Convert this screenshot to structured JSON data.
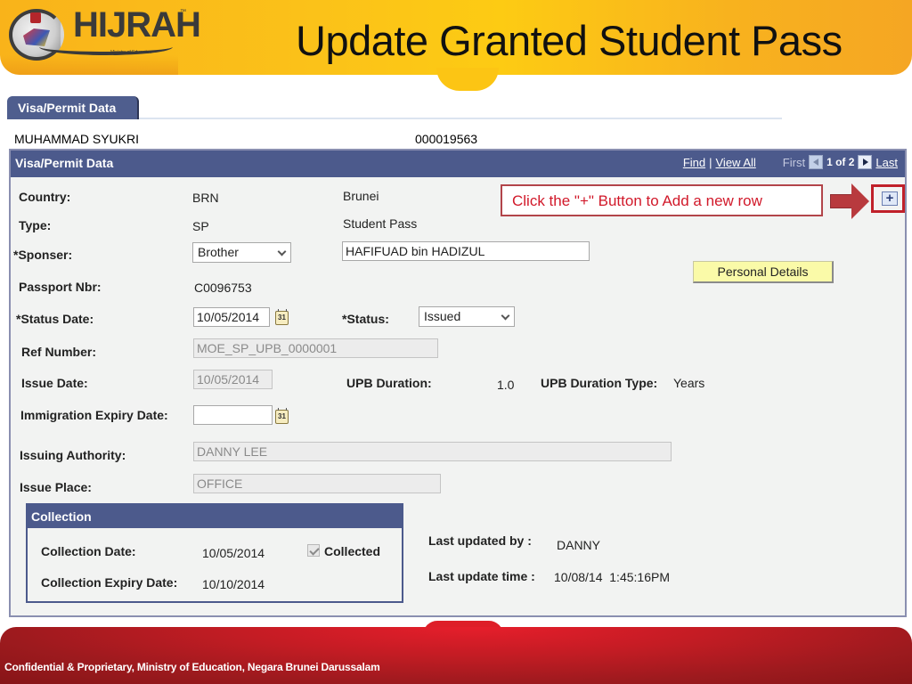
{
  "header": {
    "logo_text": "HIJRAH",
    "logo_tm": "™",
    "logo_tagline": "Ministry of Education",
    "title": "Update Granted Student Pass"
  },
  "tab": {
    "label": "Visa/Permit Data"
  },
  "person": {
    "name": "MUHAMMAD SYUKRI",
    "id": "000019563"
  },
  "panel": {
    "title": "Visa/Permit Data",
    "nav": {
      "find": "Find",
      "separator": "|",
      "view_all": "View All",
      "first": "First",
      "pager": "1 of 2",
      "last": "Last"
    }
  },
  "callout": {
    "text": "Click the \"+\" Button to Add a new row"
  },
  "add_row_button": {
    "label": "+"
  },
  "fields": {
    "country": {
      "label": "Country:",
      "code": "BRN",
      "name": "Brunei"
    },
    "type": {
      "label": "Type:",
      "code": "SP",
      "name": "Student Pass"
    },
    "sponser": {
      "label": "*Sponser:",
      "selected": "Brother",
      "name_value": "HAFIFUAD bin HADIZUL"
    },
    "passport": {
      "label": "Passport Nbr:",
      "value": "C0096753"
    },
    "status_date": {
      "label": "*Status Date:",
      "value": "10/05/2014"
    },
    "status": {
      "label": "*Status:",
      "selected": "Issued"
    },
    "ref_number": {
      "label": "Ref Number:",
      "value": "MOE_SP_UPB_0000001"
    },
    "issue_date": {
      "label": "Issue Date:",
      "value": "10/05/2014"
    },
    "upb_duration": {
      "label": "UPB Duration:",
      "value": "1.0"
    },
    "upb_duration_type": {
      "label": "UPB Duration Type:",
      "value": "Years"
    },
    "immigration_expiry": {
      "label": "Immigration Expiry Date:",
      "value": ""
    },
    "issuing_authority": {
      "label": "Issuing Authority:",
      "value": "DANNY LEE"
    },
    "issue_place": {
      "label": "Issue Place:",
      "value": "OFFICE"
    }
  },
  "calendar_icon_text": "31",
  "personal_details_button": {
    "label": "Personal Details"
  },
  "collection": {
    "title": "Collection",
    "collection_date": {
      "label": "Collection Date:",
      "value": "10/05/2014"
    },
    "collected": {
      "label": "Collected",
      "checked": true
    },
    "collection_expiry": {
      "label": "Collection Expiry Date:",
      "value": "10/10/2014"
    }
  },
  "audit": {
    "updated_by": {
      "label": "Last updated by :",
      "value": "DANNY"
    },
    "update_time": {
      "label": "Last update time :",
      "value": "10/08/14  1:45:16PM"
    }
  },
  "footer": {
    "text": "Confidential & Proprietary, Ministry of Education, Negara Brunei Darussalam"
  },
  "colors": {
    "banner": "#fbc219",
    "panel_header": "#4c5a8c",
    "callout_text": "#d1192a",
    "highlight": "#c0202a",
    "footer": "#c41c24"
  }
}
